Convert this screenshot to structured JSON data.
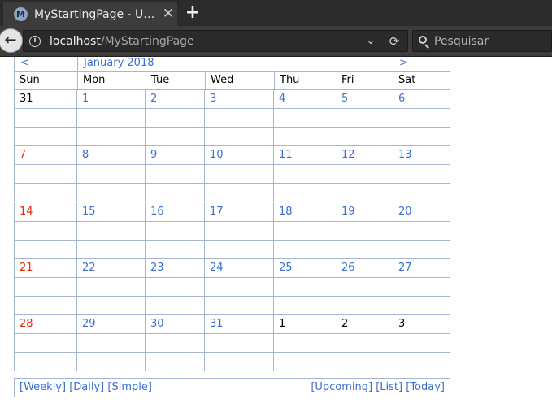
{
  "browser": {
    "tab_title": "MyStartingPage - U…",
    "tab_favicon_letter": "M",
    "close_glyph": "✕",
    "new_tab_glyph": "+",
    "url_host": "localhost",
    "url_path": "/MyStartingPage",
    "search_placeholder": "Pesquisar"
  },
  "calendar": {
    "prev": "<",
    "next": ">",
    "month_label": "January 2018",
    "weekdays": [
      "Sun",
      "Mon",
      "Tue",
      "Wed",
      "Thu",
      "Fri",
      "Sat"
    ],
    "weeks": [
      [
        {
          "d": "31",
          "c": "black"
        },
        {
          "d": "1",
          "c": "blue"
        },
        {
          "d": "2",
          "c": "blue"
        },
        {
          "d": "3",
          "c": "blue"
        },
        {
          "d": "4",
          "c": "blue"
        },
        {
          "d": "5",
          "c": "blue"
        },
        {
          "d": "6",
          "c": "blue"
        }
      ],
      [
        {
          "d": "7",
          "c": "red"
        },
        {
          "d": "8",
          "c": "blue"
        },
        {
          "d": "9",
          "c": "blue"
        },
        {
          "d": "10",
          "c": "blue"
        },
        {
          "d": "11",
          "c": "blue"
        },
        {
          "d": "12",
          "c": "blue"
        },
        {
          "d": "13",
          "c": "blue"
        }
      ],
      [
        {
          "d": "14",
          "c": "red"
        },
        {
          "d": "15",
          "c": "blue"
        },
        {
          "d": "16",
          "c": "blue"
        },
        {
          "d": "17",
          "c": "blue"
        },
        {
          "d": "18",
          "c": "blue"
        },
        {
          "d": "19",
          "c": "blue"
        },
        {
          "d": "20",
          "c": "blue"
        }
      ],
      [
        {
          "d": "21",
          "c": "red"
        },
        {
          "d": "22",
          "c": "blue"
        },
        {
          "d": "23",
          "c": "blue"
        },
        {
          "d": "24",
          "c": "blue"
        },
        {
          "d": "25",
          "c": "blue"
        },
        {
          "d": "26",
          "c": "blue"
        },
        {
          "d": "27",
          "c": "blue"
        }
      ],
      [
        {
          "d": "28",
          "c": "red"
        },
        {
          "d": "29",
          "c": "blue"
        },
        {
          "d": "30",
          "c": "blue"
        },
        {
          "d": "31",
          "c": "blue"
        },
        {
          "d": "1",
          "c": "black"
        },
        {
          "d": "2",
          "c": "black"
        },
        {
          "d": "3",
          "c": "black"
        }
      ]
    ]
  },
  "footer": {
    "weekly": "[Weekly]",
    "daily": "[Daily]",
    "simple": "[Simple]",
    "upcoming": "[Upcoming]",
    "list": "[List]",
    "today": "[Today]"
  },
  "colors": {
    "link": "#3a6fd3",
    "sunday": "#e02a10",
    "grid": "#a9b6d3",
    "chrome": "#3c3c3c"
  }
}
